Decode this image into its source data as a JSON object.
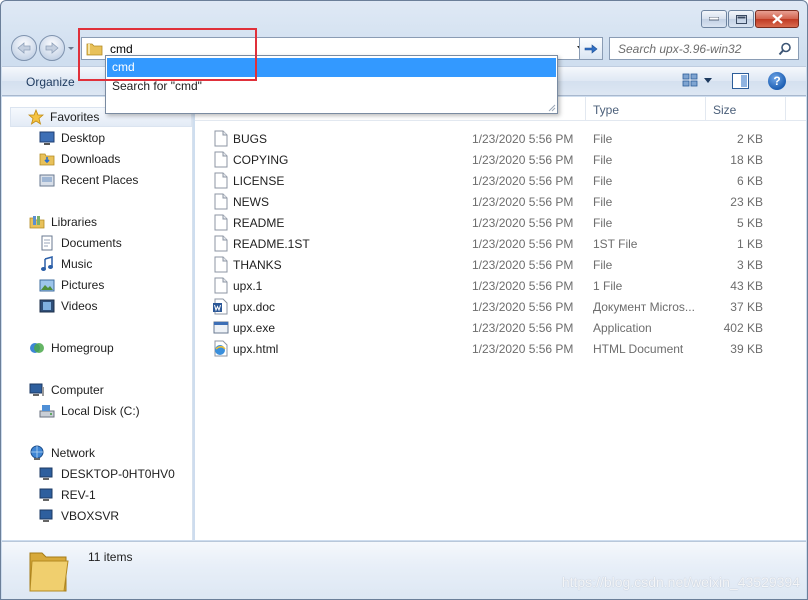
{
  "address": {
    "value": "cmd"
  },
  "search": {
    "placeholder": "Search upx-3.96-win32"
  },
  "toolbar": {
    "organize_label": "Organize"
  },
  "autocomplete": {
    "suggestion": "cmd",
    "search_label": "Search for \"cmd\""
  },
  "nav": {
    "favorites": {
      "label": "Favorites",
      "items": [
        {
          "label": "Desktop"
        },
        {
          "label": "Downloads"
        },
        {
          "label": "Recent Places"
        }
      ]
    },
    "libraries": {
      "label": "Libraries",
      "items": [
        {
          "label": "Documents"
        },
        {
          "label": "Music"
        },
        {
          "label": "Pictures"
        },
        {
          "label": "Videos"
        }
      ]
    },
    "homegroup": {
      "label": "Homegroup"
    },
    "computer": {
      "label": "Computer",
      "items": [
        {
          "label": "Local Disk (C:)"
        }
      ]
    },
    "network": {
      "label": "Network",
      "items": [
        {
          "label": "DESKTOP-0HT0HV0"
        },
        {
          "label": "REV-1"
        },
        {
          "label": "VBOXSVR"
        }
      ]
    }
  },
  "columns": {
    "type": "Type",
    "size": "Size"
  },
  "files": [
    {
      "name": "BUGS",
      "date": "1/23/2020 5:56 PM",
      "type": "File",
      "size": "2 KB",
      "icon": "file-icon"
    },
    {
      "name": "COPYING",
      "date": "1/23/2020 5:56 PM",
      "type": "File",
      "size": "18 KB",
      "icon": "file-icon"
    },
    {
      "name": "LICENSE",
      "date": "1/23/2020 5:56 PM",
      "type": "File",
      "size": "6 KB",
      "icon": "file-icon"
    },
    {
      "name": "NEWS",
      "date": "1/23/2020 5:56 PM",
      "type": "File",
      "size": "23 KB",
      "icon": "file-icon"
    },
    {
      "name": "README",
      "date": "1/23/2020 5:56 PM",
      "type": "File",
      "size": "5 KB",
      "icon": "file-icon"
    },
    {
      "name": "README.1ST",
      "date": "1/23/2020 5:56 PM",
      "type": "1ST File",
      "size": "1 KB",
      "icon": "file-icon"
    },
    {
      "name": "THANKS",
      "date": "1/23/2020 5:56 PM",
      "type": "File",
      "size": "3 KB",
      "icon": "file-icon"
    },
    {
      "name": "upx.1",
      "date": "1/23/2020 5:56 PM",
      "type": "1 File",
      "size": "43 KB",
      "icon": "file-icon"
    },
    {
      "name": "upx.doc",
      "date": "1/23/2020 5:56 PM",
      "type": "Документ Micros...",
      "size": "37 KB",
      "icon": "word-doc-icon"
    },
    {
      "name": "upx.exe",
      "date": "1/23/2020 5:56 PM",
      "type": "Application",
      "size": "402 KB",
      "icon": "exe-icon"
    },
    {
      "name": "upx.html",
      "date": "1/23/2020 5:56 PM",
      "type": "HTML Document",
      "size": "39 KB",
      "icon": "html-icon"
    }
  ],
  "details": {
    "count_label": "11 items"
  },
  "watermark": "https://blog.csdn.net/weixin_43529394",
  "colors": {
    "selection": "#3399ff",
    "highlight_box": "#e0303a",
    "window_frame": "#cddcee"
  }
}
